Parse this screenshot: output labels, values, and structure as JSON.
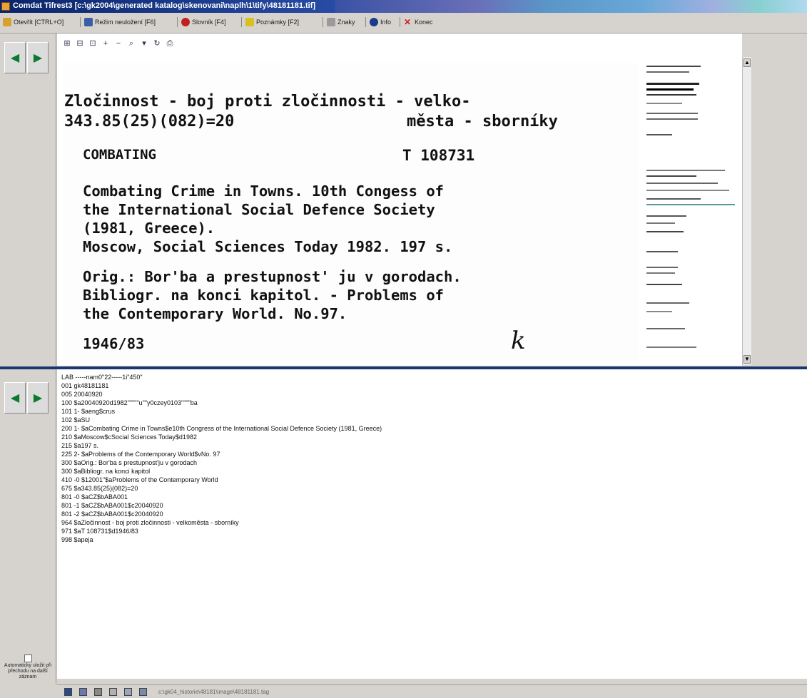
{
  "window": {
    "title": "Comdat Tifrest3 [c:\\gk2004\\generated katalog\\skenovani\\naplh\\1\\tify\\48181181.tif]"
  },
  "toolbar": {
    "items": [
      {
        "label": "Otevřít [CTRL+O]",
        "icon": "folder-icon",
        "color": "#d8a030"
      },
      {
        "label": "Režim neuložení [F6]",
        "icon": "mode-icon",
        "color": "#3a5ea8"
      },
      {
        "label": "Slovník [F4]",
        "icon": "dictionary-icon",
        "color": "#c02020"
      },
      {
        "label": "Poznámky [F2]",
        "icon": "notes-icon",
        "color": "#d8c020"
      },
      {
        "label": "Znaky",
        "icon": "chars-icon",
        "color": "#808080"
      },
      {
        "label": "Info",
        "icon": "info-icon",
        "color": "#1a3a8a"
      },
      {
        "label": "Konec",
        "icon": "close-icon",
        "color": "#d02020"
      }
    ]
  },
  "viewer_toolbar": [
    "⊞",
    "⊟",
    "⊡",
    "+",
    "−",
    "⌕",
    "▾",
    "↻",
    "⎙"
  ],
  "card": {
    "line1": "Zločinnost - boj proti zločinnosti - velko-",
    "line2": "343.85(25)(082)=20",
    "line2b": "města - sborníky",
    "line3": "COMBATING",
    "line3b": "T 108731",
    "body": [
      "Combating Crime in Towns. 10th Congess of",
      "the International Social Defence Society",
      "(1981, Greece).",
      "Moscow, Social Sciences Today 1982. 197 s.",
      "Orig.: Bor'ba a prestupnost' ju v gorodach.",
      "Bibliogr. na konci kapitol. - Problems of",
      "the Contemporary World. No.97."
    ],
    "footer": "1946/83",
    "mark": "k"
  },
  "record": {
    "lines": [
      "LAB    -----nam0\"22-----1i\"450\"",
      "001   gk48181181",
      "005   20040920",
      "100   $a20040920d1982\"\"\"\"\"u\"\"y0czey0103\"\"\"\"ba",
      "101 1-  $aeng$crus",
      "102   $aSU",
      "200 1-  $aCombating Crime in Towns$e10th Congress of the International Social Defence Society (1981, Greece)",
      "210   $aMoscow$cSocial Sciences Today$d1982",
      "215   $a197 s.",
      "225 2-  $aProblems of the Contemporary World$vNo. 97",
      "300   $aOrig.: Bor'ba s prestupnost'ju v gorodach",
      "300   $aBibliogr. na konci kapitol",
      "410 -0  $12001\"$aProblems of the Contemporary World",
      "675   $a343.85(25)(082)=20",
      "801 -0  $aCZ$bABA001",
      "801 -1  $aCZ$bABA001$c20040920",
      "801 -2  $aCZ$bABA001$c20040920",
      "964   $aZločinnost - boj proti zločinnosti - velkoměsta - sborníky",
      "971   $aT 108731$d1946/83",
      "998   $apeja"
    ]
  },
  "auto_label": "Automaticky uložit při přechodu na další záznam",
  "status_path": "c:\\gk04_historie\\48181\\image\\48181181.tag",
  "nav": {
    "prev": "◀",
    "next": "▶"
  },
  "scroll": {
    "up": "▲",
    "down": "▼"
  }
}
